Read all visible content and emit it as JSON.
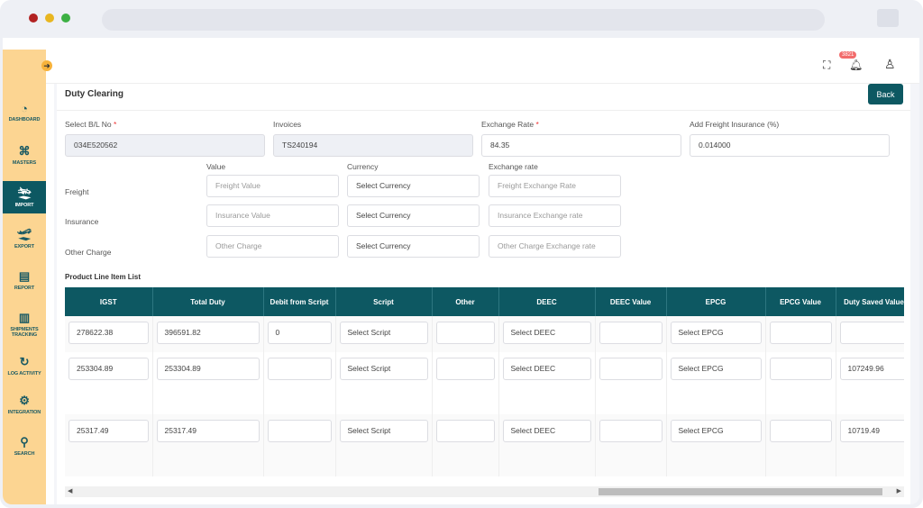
{
  "sidebar": {
    "items": [
      {
        "label": "DASHBOARD",
        "icon": "dashboard-icon"
      },
      {
        "label": "MASTERS",
        "icon": "masters-icon"
      },
      {
        "label": "IMPORT",
        "icon": "import-icon",
        "active": true
      },
      {
        "label": "EXPORT",
        "icon": "export-icon"
      },
      {
        "label": "REPORT",
        "icon": "report-icon"
      },
      {
        "label": "SHIPMENTS TRACKING",
        "icon": "map-icon"
      },
      {
        "label": "LOG ACTIVITY",
        "icon": "history-icon"
      },
      {
        "label": "INTEGRATION",
        "icon": "gears-icon"
      },
      {
        "label": "SEARCH",
        "icon": "search-icon"
      }
    ]
  },
  "header": {
    "notification_count": "3821"
  },
  "page": {
    "title": "Duty Clearing",
    "back_label": "Back"
  },
  "form": {
    "bl_label": "Select B/L No",
    "bl_value": "034E520562",
    "invoices_label": "Invoices",
    "invoices_value": "TS240194",
    "exchange_rate_label": "Exchange Rate",
    "exchange_rate_value": "84.35",
    "freight_ins_label": "Add Freight Insurance (%)",
    "freight_ins_value": "0.014000",
    "col_value": "Value",
    "col_currency": "Currency",
    "col_exrate": "Exchange rate",
    "rows": [
      {
        "label": "Freight",
        "value_ph": "Freight Value",
        "currency": "Select Currency",
        "rate_ph": "Freight Exchange Rate"
      },
      {
        "label": "Insurance",
        "value_ph": "Insurance Value",
        "currency": "Select Currency",
        "rate_ph": "Insurance Exchange rate"
      },
      {
        "label": "Other Charge",
        "value_ph": "Other Charge",
        "currency": "Select Currency",
        "rate_ph": "Other Charge Exchange rate"
      }
    ]
  },
  "table": {
    "title": "Product Line Item List",
    "columns": [
      "IGST",
      "Total Duty",
      "Debit from Script",
      "Script",
      "Other",
      "DEEC",
      "DEEC Value",
      "EPCG",
      "EPCG Value",
      "Duty Saved Value"
    ],
    "rows": [
      [
        "278622.38",
        "396591.82",
        "0",
        "Select Script",
        "",
        "Select DEEC",
        "",
        "Select EPCG",
        "",
        ""
      ],
      [
        "253304.89",
        "253304.89",
        "",
        "Select Script",
        "",
        "Select DEEC",
        "",
        "Select EPCG",
        "",
        "107249.96"
      ],
      [
        "25317.49",
        "25317.49",
        "",
        "Select Script",
        "",
        "Select DEEC",
        "",
        "Select EPCG",
        "",
        "10719.49"
      ]
    ]
  },
  "colors": {
    "sidebar": "#fcd592",
    "accent": "#0d5862",
    "badge": "#f26b6b"
  }
}
